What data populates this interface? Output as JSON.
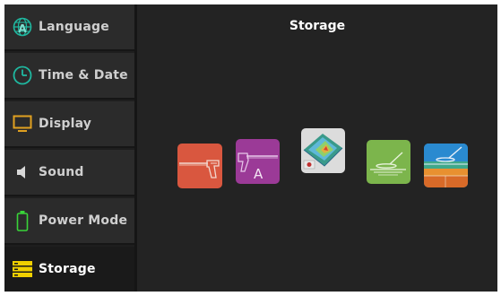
{
  "page": {
    "title": "Storage"
  },
  "sidebar": {
    "items": [
      {
        "label": "Language",
        "icon": "globe-a-icon",
        "active": false
      },
      {
        "label": "Time & Date",
        "icon": "clock-icon",
        "active": false
      },
      {
        "label": "Display",
        "icon": "monitor-icon",
        "active": false
      },
      {
        "label": "Sound",
        "icon": "speaker-icon",
        "active": false
      },
      {
        "label": "Power Mode",
        "icon": "battery-icon",
        "active": false
      },
      {
        "label": "Storage",
        "icon": "storage-icon",
        "active": true
      }
    ]
  },
  "tiles": [
    {
      "name": "detector-gun",
      "color": "#d9573f"
    },
    {
      "name": "detector-mode-a",
      "color": "#9b3a97",
      "badge": "A"
    },
    {
      "name": "terrain-3d",
      "color": "#dcdcdc"
    },
    {
      "name": "ground-scan",
      "color": "#7cb54c"
    },
    {
      "name": "depth-scan",
      "color": "#2a8ad0"
    }
  ],
  "colors": {
    "sidebar_icon": "#1fb8a0",
    "active_icon": "#f0d000",
    "battery": "#39d339"
  }
}
